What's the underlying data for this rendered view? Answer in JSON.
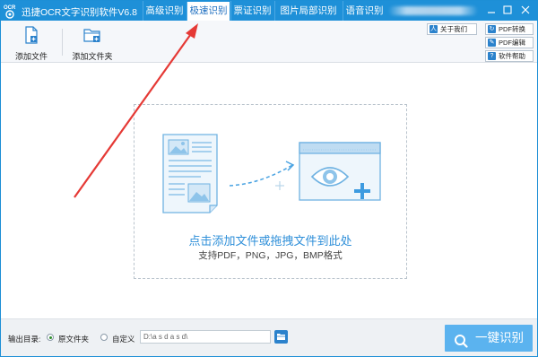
{
  "app": {
    "title": "迅捷OCR文字识别软件V6.8",
    "logo_text": "OCR"
  },
  "tabs": [
    {
      "label": "高级识别"
    },
    {
      "label": "极速识别"
    },
    {
      "label": "票证识别"
    },
    {
      "label": "图片局部识别"
    },
    {
      "label": "语音识别"
    }
  ],
  "toolbar": {
    "add_file_label": "添加文件",
    "add_folder_label": "添加文件夹",
    "about_label": "关于我们",
    "pdf_convert_label": "PDF转换",
    "pdf_edit_label": "PDF编辑",
    "help_label": "软件帮助"
  },
  "dropzone": {
    "main_text": "点击添加文件或拖拽文件到此处",
    "sub_text": "支持PDF，PNG，JPG，BMP格式"
  },
  "bottom": {
    "output_label": "输出目录:",
    "option_original": "原文件夹",
    "option_custom": "自定义",
    "custom_path": "D:\\a s d a s d\\",
    "ocr_button_label": "一键识别"
  },
  "colors": {
    "title_bar": "#1e90d8",
    "accent": "#2e8fd9",
    "ocr_button": "#5bb3ef",
    "annotation_arrow": "#e53935"
  }
}
